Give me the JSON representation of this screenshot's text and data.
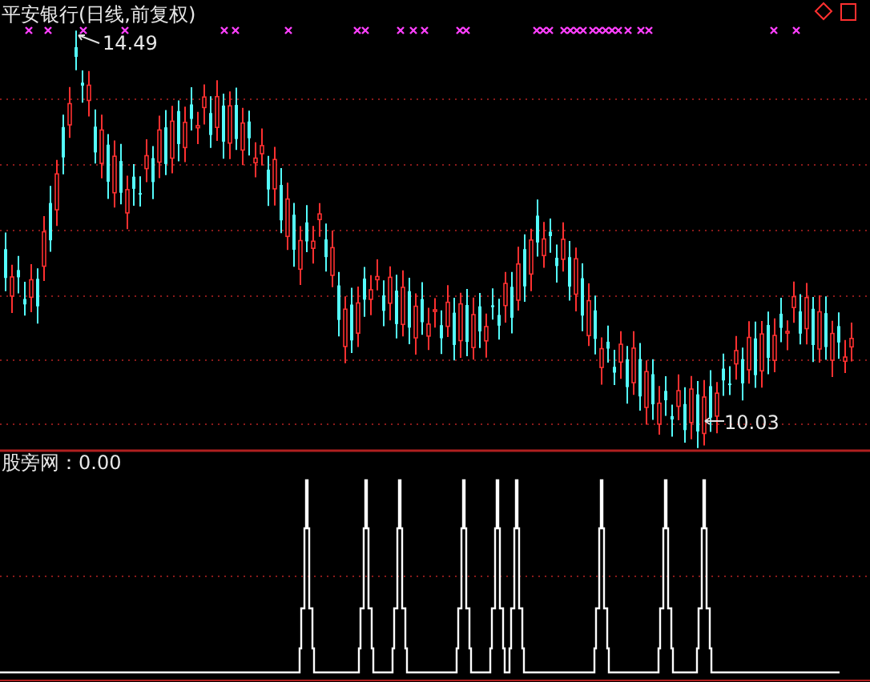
{
  "chart_title": "平安银行(日线,前复权)",
  "high_label": "14.49",
  "low_label": "10.03",
  "indicator": {
    "label": "股旁网：0.00"
  }
}
